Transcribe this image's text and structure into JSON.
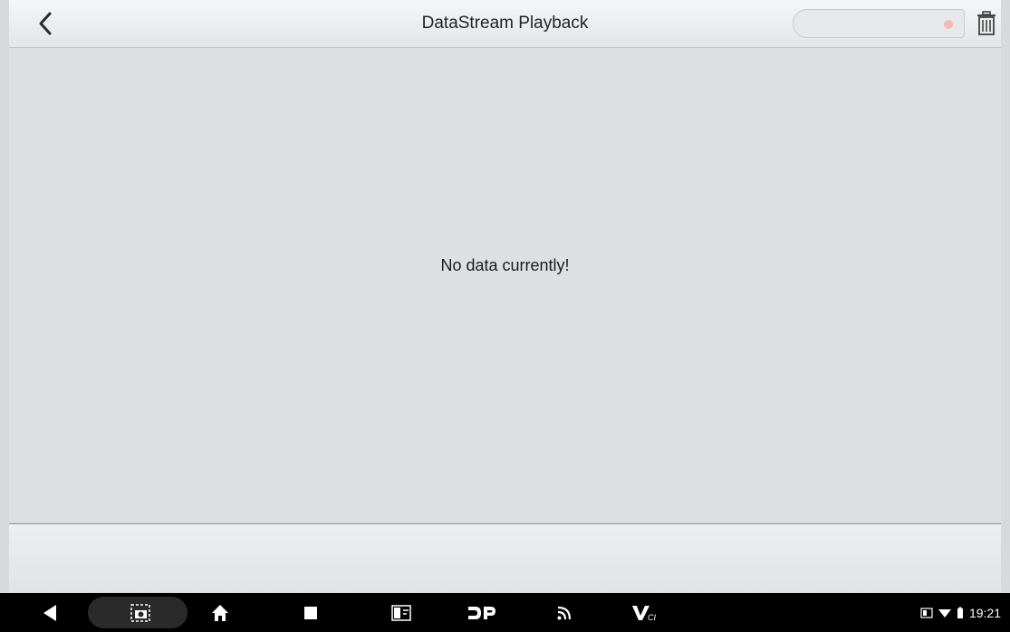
{
  "header": {
    "title": "DataStream Playback",
    "back_icon": "chevron-left-icon",
    "search_value": "",
    "delete_icon": "trash-icon"
  },
  "content": {
    "empty_message": "No data currently!"
  },
  "system_bar": {
    "buttons": [
      {
        "name": "back",
        "icon": "triangle-back-icon"
      },
      {
        "name": "screenshot",
        "icon": "camera-icon"
      },
      {
        "name": "home",
        "icon": "home-icon"
      },
      {
        "name": "recents",
        "icon": "square-icon"
      },
      {
        "name": "split",
        "icon": "split-window-icon"
      },
      {
        "name": "dp",
        "icon": "dp-icon"
      },
      {
        "name": "cast",
        "icon": "signal-icon"
      },
      {
        "name": "vci",
        "icon": "vci-icon"
      }
    ],
    "time": "19:21"
  },
  "colors": {
    "background": "#dde0e3",
    "header": "#eef0f2",
    "navbar": "#000000"
  }
}
